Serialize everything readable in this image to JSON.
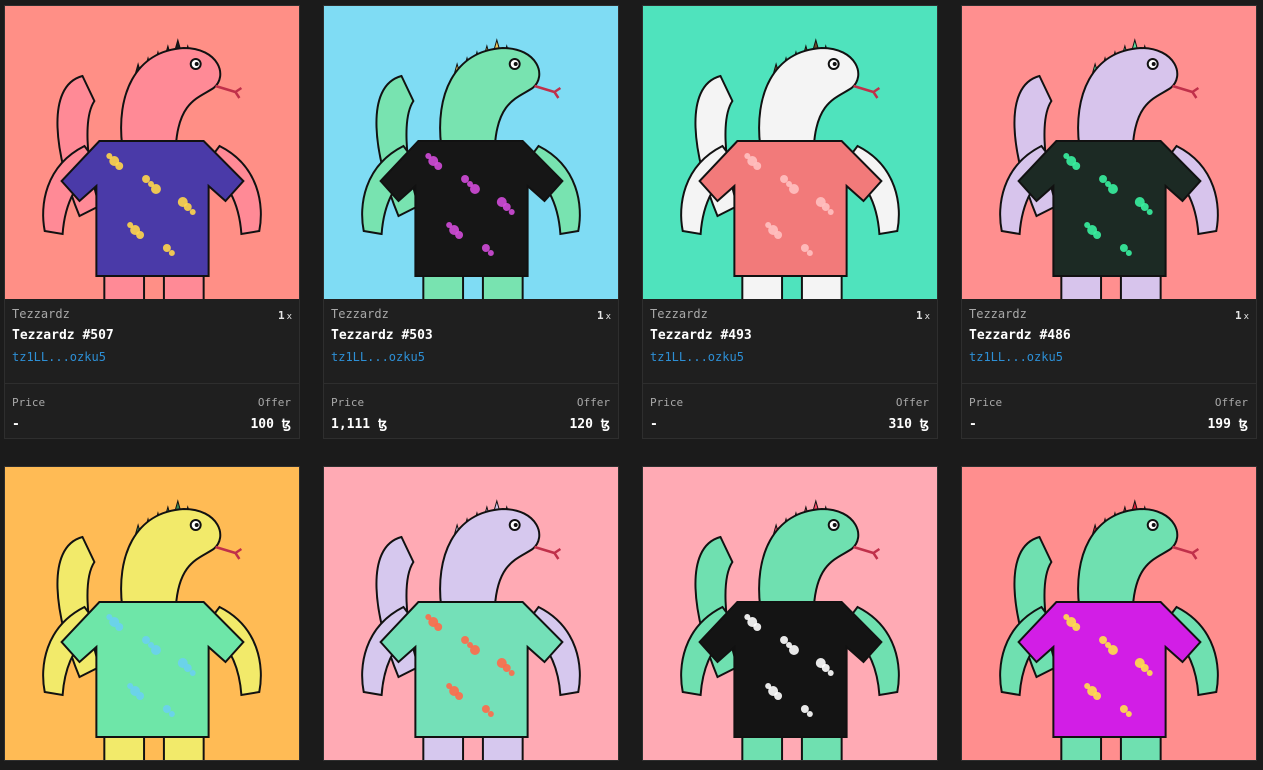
{
  "colors": {
    "page_bg": "#1b1b1b",
    "creator_link": "#2d8fd5"
  },
  "cards": [
    {
      "collection": "Tezzardz",
      "editions": "1",
      "editions_suffix": "x",
      "title": "Tezzardz #507",
      "creator": "tz1LL...ozku5",
      "price_label": "Price",
      "price": "-",
      "offer_label": "Offer",
      "offer": "100 ꜩ",
      "bg": "#ff8f86",
      "body": "#ff8a96",
      "shirt": "#4a3aa8",
      "shirt_accent": "#ffd64a",
      "spikes": "#1a1a1a"
    },
    {
      "collection": "Tezzardz",
      "editions": "1",
      "editions_suffix": "x",
      "title": "Tezzardz #503",
      "creator": "tz1LL...ozku5",
      "price_label": "Price",
      "price": "1,111 ꜩ",
      "offer_label": "Offer",
      "offer": "120 ꜩ",
      "bg": "#7fdcf4",
      "body": "#78e3b0",
      "shirt": "#161616",
      "shirt_accent": "#d04bd8",
      "spikes": "#f0c85a"
    },
    {
      "collection": "Tezzardz",
      "editions": "1",
      "editions_suffix": "x",
      "title": "Tezzardz #493",
      "creator": "tz1LL...ozku5",
      "price_label": "Price",
      "price": "-",
      "offer_label": "Offer",
      "offer": "310 ꜩ",
      "bg": "#4fe3bd",
      "body": "#f4f4f4",
      "shirt": "#f27a7a",
      "shirt_accent": "#ffc0c0",
      "spikes": "#6b4c2a"
    },
    {
      "collection": "Tezzardz",
      "editions": "1",
      "editions_suffix": "x",
      "title": "Tezzardz #486",
      "creator": "tz1LL...ozku5",
      "price_label": "Price",
      "price": "-",
      "offer_label": "Offer",
      "offer": "199 ꜩ",
      "bg": "#ff8f8f",
      "body": "#d7c4ec",
      "shirt": "#1c2a24",
      "shirt_accent": "#38f0a0",
      "spikes": "#5fe0a0"
    },
    {
      "collection": "",
      "editions": "",
      "editions_suffix": "",
      "title": "",
      "creator": "",
      "price_label": "",
      "price": "",
      "offer_label": "",
      "offer": "",
      "bg": "#ffbb55",
      "body": "#f2ea6a",
      "shirt": "#6ee6a8",
      "shirt_accent": "#6ad0f0",
      "spikes": "#3a8a54"
    },
    {
      "collection": "",
      "editions": "",
      "editions_suffix": "",
      "title": "",
      "creator": "",
      "price_label": "",
      "price": "",
      "offer_label": "",
      "offer": "",
      "bg": "#ffaab4",
      "body": "#d6c8ee",
      "shirt": "#74e0b8",
      "shirt_accent": "#ff6a4a",
      "spikes": "#d6c8ee"
    },
    {
      "collection": "",
      "editions": "",
      "editions_suffix": "",
      "title": "",
      "creator": "",
      "price_label": "",
      "price": "",
      "offer_label": "",
      "offer": "",
      "bg": "#ffaab4",
      "body": "#6fe0b0",
      "shirt": "#141414",
      "shirt_accent": "#ffffff",
      "spikes": "#ff4a6a"
    },
    {
      "collection": "",
      "editions": "",
      "editions_suffix": "",
      "title": "",
      "creator": "",
      "price_label": "",
      "price": "",
      "offer_label": "",
      "offer": "",
      "bg": "#ff8e8e",
      "body": "#6fe0b0",
      "shirt": "#d21ee6",
      "shirt_accent": "#ffe04a",
      "spikes": "#e0203a"
    }
  ]
}
